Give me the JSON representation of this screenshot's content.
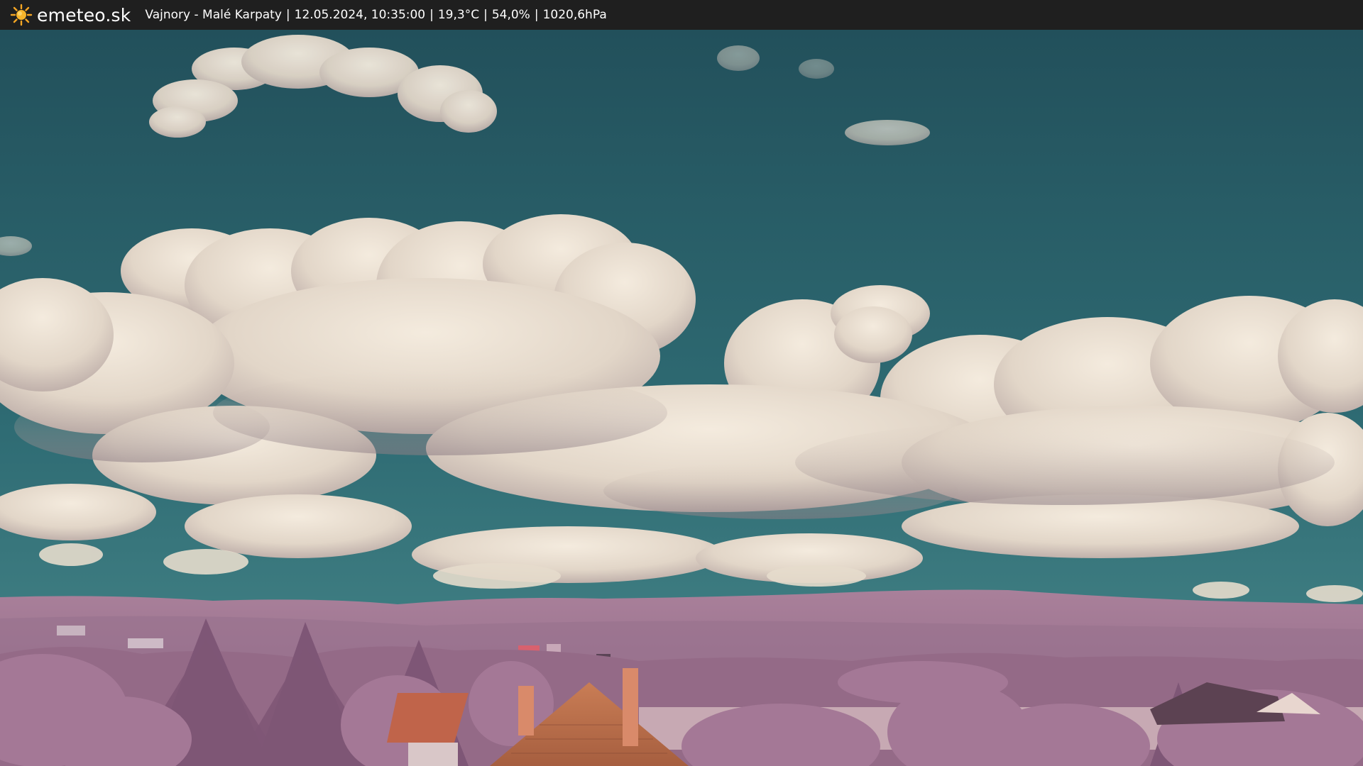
{
  "header": {
    "brand": "emeteo.sk",
    "location": "Vajnory - Malé Karpaty",
    "datetime": "12.05.2024, 10:35:00",
    "temperature": "19,3°C",
    "humidity": "54,0%",
    "pressure": "1020,6hPa",
    "separator": "|",
    "logo_icon": "sun-icon"
  },
  "colors": {
    "bar": "#1f1f1f",
    "sky_top": "#23505a",
    "sky_bottom": "#3e7f86",
    "cloud": "#e9dfd2",
    "hills": "#a57a95",
    "foliage": "#9a6f8c",
    "roof": "#c6744c",
    "sun": "#f5a623"
  }
}
